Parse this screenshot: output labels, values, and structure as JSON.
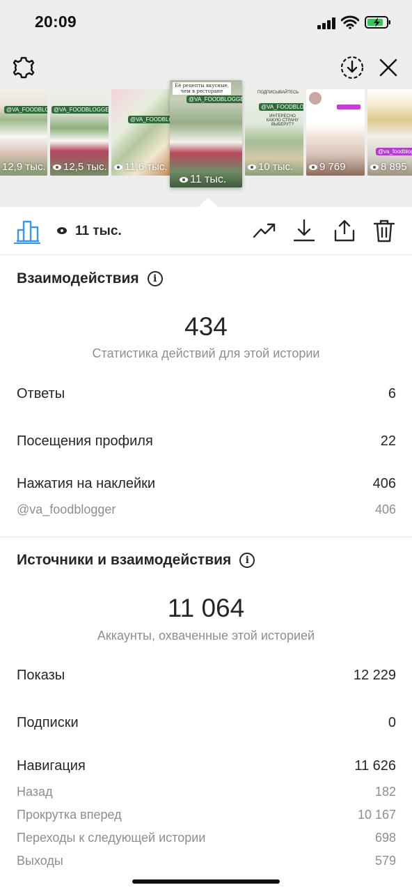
{
  "status_bar": {
    "time": "20:09"
  },
  "thumbnails": [
    {
      "views": "12,9 тыс."
    },
    {
      "views": "12,5 тыс."
    },
    {
      "views": "11,6 тыс."
    },
    {
      "views": "11 тыс."
    },
    {
      "views": "10 тыс."
    },
    {
      "views": "9 769"
    },
    {
      "views": "8 895"
    }
  ],
  "thumbnail_texts": {
    "t1_handle": "@VA_FOODBLOGGER",
    "t2_handle": "@VA_FOODBLOGGER",
    "t3_handle": "@VA_FOODBLOGGER",
    "t4_top": "Её рецепты вкусные, чем в ресторане",
    "t4_handle": "@VA_FOODBLOGGER",
    "t5_top": "ПОДПИСЫВАЙТЕСЬ",
    "t5_handle": "@VA_FOODBLOGGER",
    "t5_q": "ИНТЕРЕСНО КАКУЮ СТРАНУ ВЫБЕРУТ?",
    "t7_handle": "@va_foodblogger"
  },
  "toolbar": {
    "views": "11 тыс."
  },
  "interactions": {
    "title": "Взаимодействия",
    "total": "434",
    "caption": "Статистика действий для этой истории",
    "rows": [
      {
        "label": "Ответы",
        "value": "6"
      },
      {
        "label": "Посещения профиля",
        "value": "22"
      },
      {
        "label": "Нажатия на наклейки",
        "value": "406"
      }
    ],
    "sticker_sub": {
      "label": "@va_foodblogger",
      "value": "406"
    }
  },
  "discovery": {
    "title": "Источники и взаимодействия",
    "total": "11 064",
    "caption": "Аккаунты, охваченные этой историей",
    "rows": [
      {
        "label": "Показы",
        "value": "12 229"
      },
      {
        "label": "Подписки",
        "value": "0"
      },
      {
        "label": "Навигация",
        "value": "11 626"
      }
    ],
    "navigation_sub": [
      {
        "label": "Назад",
        "value": "182"
      },
      {
        "label": "Прокрутка вперед",
        "value": "10 167"
      },
      {
        "label": "Переходы к следующей истории",
        "value": "698"
      },
      {
        "label": "Выходы",
        "value": "579"
      }
    ]
  },
  "colors": {
    "accent": "#3897f0",
    "muted": "#8e8e8e",
    "text": "#262626",
    "top_bg": "#ededed"
  }
}
